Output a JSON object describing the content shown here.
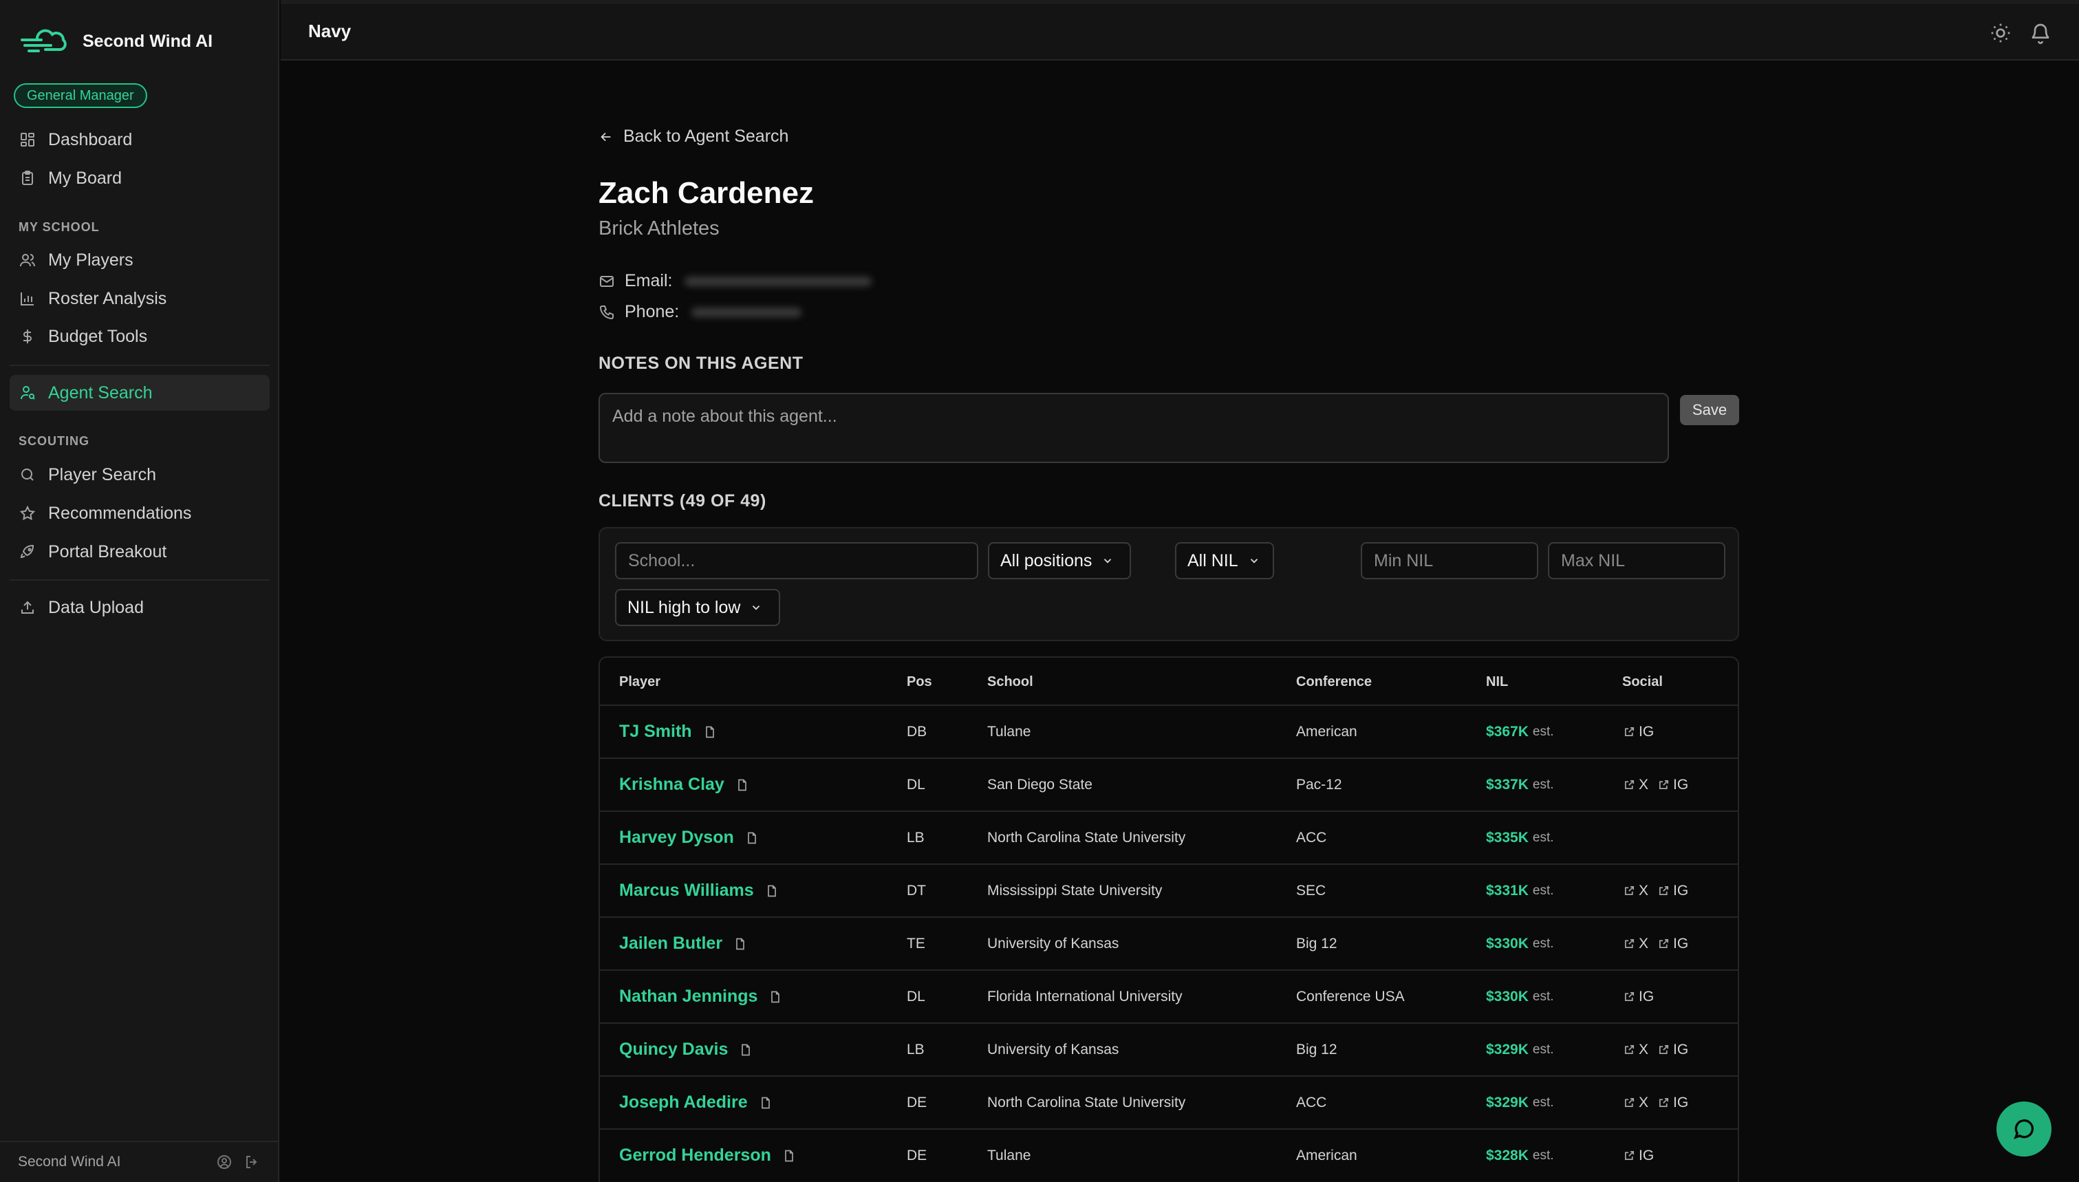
{
  "brand": {
    "name": "Second Wind AI",
    "role": "General Manager"
  },
  "nav": {
    "dashboard": "Dashboard",
    "my_board": "My Board",
    "my_school_label": "MY SCHOOL",
    "my_players": "My Players",
    "roster_analysis": "Roster Analysis",
    "budget_tools": "Budget Tools",
    "agent_search": "Agent Search",
    "scouting_label": "SCOUTING",
    "player_search": "Player Search",
    "recommendations": "Recommendations",
    "portal_breakout": "Portal Breakout",
    "data_upload": "Data Upload"
  },
  "footer": {
    "name": "Second Wind AI"
  },
  "topbar": {
    "team": "Navy"
  },
  "agent": {
    "back_label": "Back to Agent Search",
    "name": "Zach Cardenez",
    "company": "Brick Athletes",
    "email_label": "Email:",
    "phone_label": "Phone:"
  },
  "notes": {
    "title": "NOTES ON THIS AGENT",
    "placeholder": "Add a note about this agent...",
    "save_label": "Save"
  },
  "clients": {
    "title": "CLIENTS (49 OF 49)",
    "filters": {
      "school_placeholder": "School...",
      "positions": "All positions",
      "nil": "All NIL",
      "min_placeholder": "Min NIL",
      "max_placeholder": "Max NIL",
      "sort": "NIL high to low"
    },
    "headers": [
      "Player",
      "Pos",
      "School",
      "Conference",
      "NIL",
      "Social"
    ],
    "est_label": "est.",
    "rows": [
      {
        "player": "TJ Smith",
        "pos": "DB",
        "school": "Tulane",
        "conference": "American",
        "nil": "$367K",
        "x": "",
        "ig": "IG"
      },
      {
        "player": "Krishna Clay",
        "pos": "DL",
        "school": "San Diego State",
        "conference": "Pac-12",
        "nil": "$337K",
        "x": "X",
        "ig": "IG"
      },
      {
        "player": "Harvey Dyson",
        "pos": "LB",
        "school": "North Carolina State University",
        "conference": "ACC",
        "nil": "$335K",
        "x": "",
        "ig": ""
      },
      {
        "player": "Marcus Williams",
        "pos": "DT",
        "school": "Mississippi State University",
        "conference": "SEC",
        "nil": "$331K",
        "x": "X",
        "ig": "IG"
      },
      {
        "player": "Jailen Butler",
        "pos": "TE",
        "school": "University of Kansas",
        "conference": "Big 12",
        "nil": "$330K",
        "x": "X",
        "ig": "IG"
      },
      {
        "player": "Nathan Jennings",
        "pos": "DL",
        "school": "Florida International University",
        "conference": "Conference USA",
        "nil": "$330K",
        "x": "",
        "ig": "IG"
      },
      {
        "player": "Quincy Davis",
        "pos": "LB",
        "school": "University of Kansas",
        "conference": "Big 12",
        "nil": "$329K",
        "x": "X",
        "ig": "IG"
      },
      {
        "player": "Joseph Adedire",
        "pos": "DE",
        "school": "North Carolina State University",
        "conference": "ACC",
        "nil": "$329K",
        "x": "X",
        "ig": "IG"
      },
      {
        "player": "Gerrod Henderson",
        "pos": "DE",
        "school": "Tulane",
        "conference": "American",
        "nil": "$328K",
        "x": "",
        "ig": "IG"
      }
    ]
  },
  "colors": {
    "accent": "#34d399",
    "background": "#0a0a0a",
    "sidebar": "#171717"
  },
  "icons": [
    "logo-icon",
    "dashboard-icon",
    "clipboard-icon",
    "users-icon",
    "bar-chart-icon",
    "dollar-icon",
    "user-search-icon",
    "search-icon",
    "star-icon",
    "rocket-icon",
    "upload-icon",
    "sun-icon",
    "bell-icon",
    "arrow-left-icon",
    "mail-icon",
    "phone-icon",
    "chevron-down-icon",
    "document-icon",
    "external-link-icon",
    "chat-icon"
  ]
}
